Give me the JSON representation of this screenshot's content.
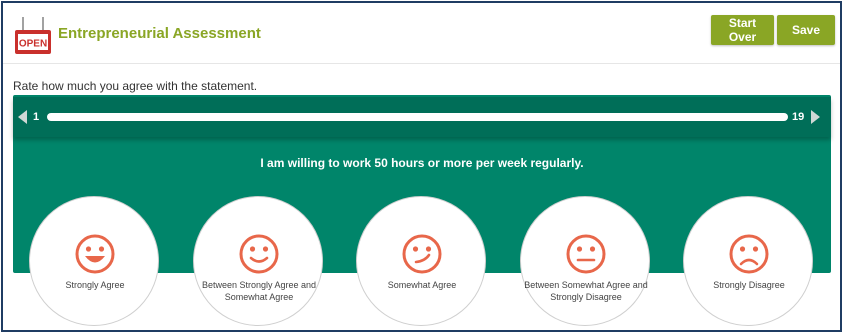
{
  "header": {
    "logo_text": "OPEN",
    "title": "Entrepreneurial Assessment",
    "start_over_label": "Start Over",
    "save_label": "Save"
  },
  "prompt": "Rate how much you agree with the statement.",
  "slider": {
    "min_label": "1",
    "max_label": "19"
  },
  "statement": "I am willing to work 50 hours or more per week regularly.",
  "options": [
    {
      "label": "Strongly Agree",
      "icon": "very-happy-face-icon"
    },
    {
      "label": "Between Strongly Agree and Somewhat Agree",
      "icon": "happy-face-icon"
    },
    {
      "label": "Somewhat Agree",
      "icon": "wink-face-icon"
    },
    {
      "label": "Between Somewhat Agree and Strongly Disagree",
      "icon": "neutral-face-icon"
    },
    {
      "label": "Strongly Disagree",
      "icon": "sad-face-icon"
    }
  ],
  "colors": {
    "brand_green": "#8aa625",
    "panel_teal": "#00856a",
    "face_orange": "#e8674a",
    "logo_red": "#c9302c"
  }
}
